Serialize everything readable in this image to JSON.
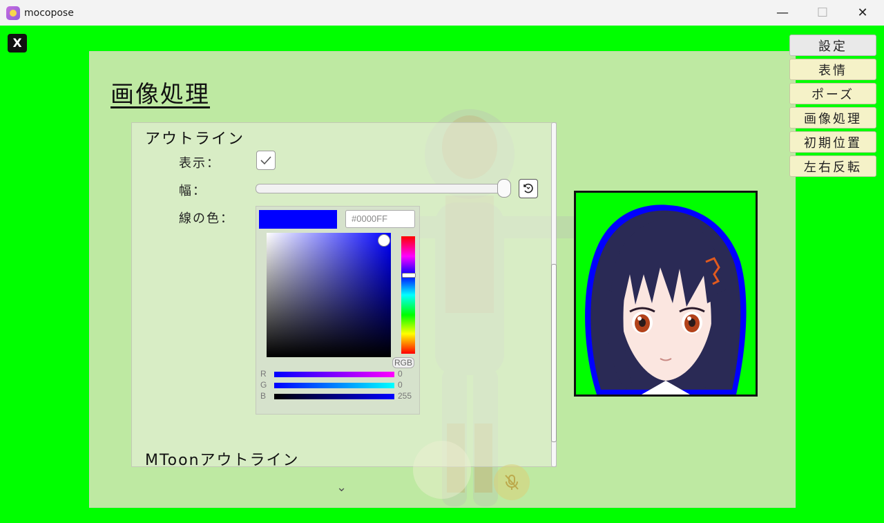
{
  "window": {
    "title": "mocopose"
  },
  "close_overlay_label": "X",
  "panel": {
    "title": "画像処理"
  },
  "outline": {
    "section_title": "アウトライン",
    "show_label": "表示：",
    "show_checked": true,
    "width_label": "幅：",
    "width_value": 1.0,
    "color_label": "線の色：",
    "color_hex_placeholder": "#0000FF",
    "color_value": "#0000ff",
    "color_mode": "RGB",
    "channels": [
      {
        "name": "R",
        "value": "0"
      },
      {
        "name": "G",
        "value": "0"
      },
      {
        "name": "B",
        "value": "255"
      }
    ]
  },
  "mtoon_section_title": "MToonアウトライン",
  "menu": {
    "items": [
      {
        "label": "設定",
        "active": true
      },
      {
        "label": "表情",
        "active": false
      },
      {
        "label": "ポーズ",
        "active": false
      },
      {
        "label": "画像処理",
        "active": false
      },
      {
        "label": "初期位置",
        "active": false
      },
      {
        "label": "左右反転",
        "active": false
      }
    ]
  },
  "colors": {
    "background": "#00ff00",
    "outline": "#0000ff",
    "hair": "#2a2a55"
  }
}
